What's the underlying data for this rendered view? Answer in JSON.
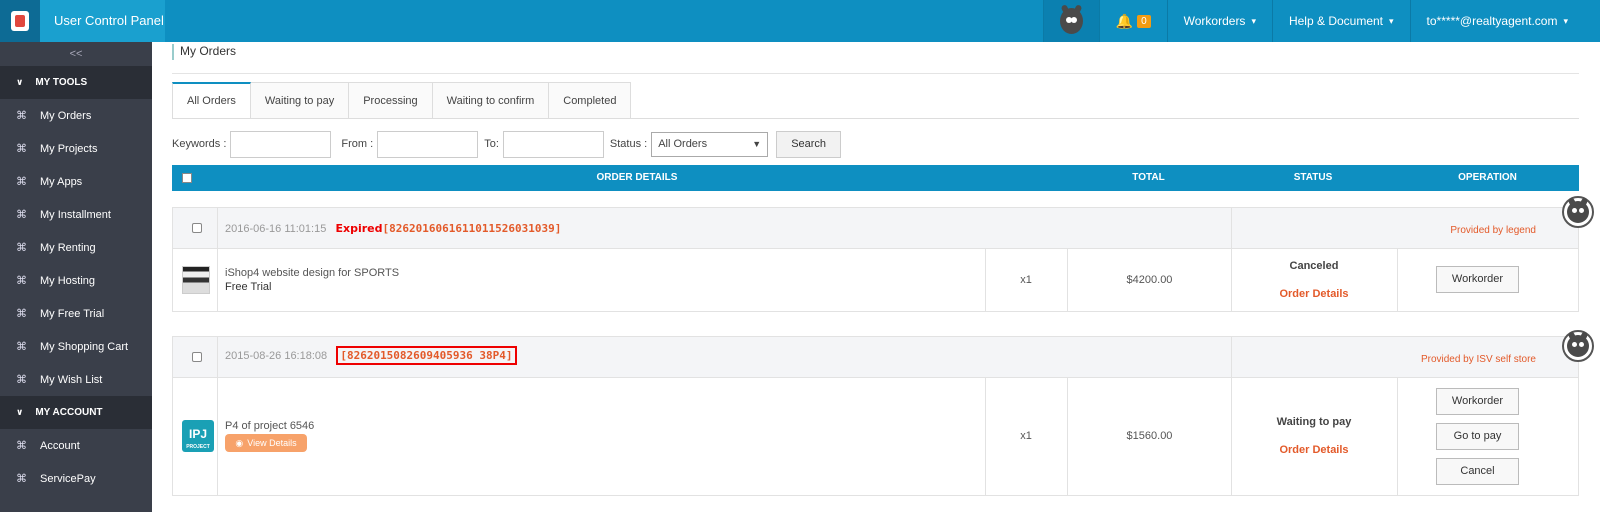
{
  "topbar": {
    "title": "User Control Panel",
    "notifications": "0",
    "workorders": "Workorders",
    "help": "Help & Document",
    "account": "to*****@realtyagent.com"
  },
  "sidebar": {
    "collapse": "<<",
    "sections": [
      {
        "label": "MY TOOLS",
        "items": [
          "My Orders",
          "My Projects",
          "My Apps",
          "My Installment",
          "My Renting",
          "My Hosting",
          "My Free Trial",
          "My Shopping Cart",
          "My Wish List"
        ]
      },
      {
        "label": "MY ACCOUNT",
        "items": [
          "Account",
          "ServicePay"
        ]
      }
    ]
  },
  "main": {
    "page_title": "My Orders",
    "tabs": [
      "All Orders",
      "Waiting to pay",
      "Processing",
      "Waiting to confirm",
      "Completed"
    ],
    "filter": {
      "keywords_label": "Keywords :",
      "from_label": "From :",
      "to_label": "To:",
      "status_label": "Status :",
      "status_value": "All Orders",
      "search_button": "Search"
    },
    "table_headers": {
      "details": "ORDER DETAILS",
      "total": "TOTAL",
      "status": "STATUS",
      "operation": "OPERATION"
    },
    "orders": [
      {
        "date": "2016-06-16 11:01:15",
        "status_tag": "Expired",
        "order_id": "[8262016061611011526031039]",
        "provider": "Provided by legend",
        "product": "iShop4 website design for SPORTS",
        "subtitle": "Free Trial",
        "qty": "x1",
        "price": "$4200.00",
        "status": "Canceled",
        "details_link": "Order Details",
        "buttons": [
          "Workorder"
        ]
      },
      {
        "date": "2015-08-26 16:18:08",
        "status_tag": "",
        "order_id": "[8262015082609405936 38P4]",
        "provider": "Provided by ISV self store",
        "product": "P4 of project 6546",
        "view_details": "View Details",
        "thumb_text": "IPJ",
        "thumb_sub": "PROJECT",
        "qty": "x1",
        "price": "$1560.00",
        "status": "Waiting to pay",
        "details_link": "Order Details",
        "buttons": [
          "Workorder",
          "Go to pay",
          "Cancel"
        ]
      }
    ]
  },
  "colors": {
    "primary": "#0e8fc1",
    "sidebar": "#3a3f4a",
    "accent": "#e35a2a",
    "alert": "#e00000"
  }
}
